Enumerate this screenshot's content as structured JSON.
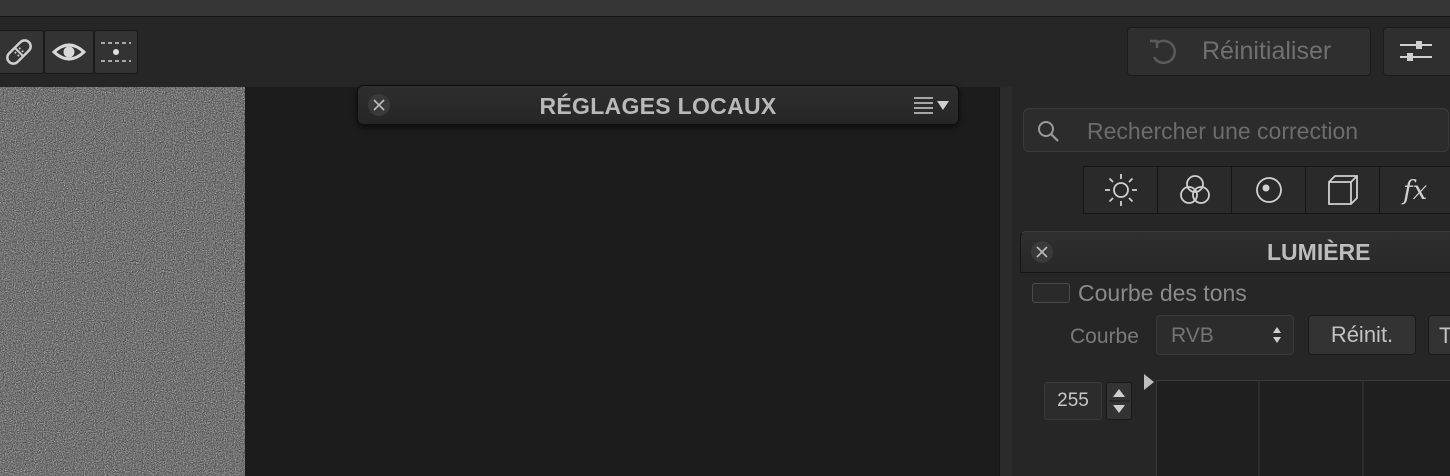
{
  "toolbar": {
    "left_tools": [
      {
        "icon": "bandage-icon"
      },
      {
        "icon": "eye-icon"
      },
      {
        "icon": "split-view-icon"
      }
    ],
    "reset_label": "Réinitialiser",
    "reset_icon": "undo-icon",
    "prefs_icon": "sliders-icon"
  },
  "local_panel": {
    "title": "RÉGLAGES LOCAUX",
    "close_icon": "close-icon",
    "menu_icon": "list-menu-icon"
  },
  "inspector": {
    "search": {
      "placeholder": "Rechercher une correction",
      "icon": "search-icon"
    },
    "category_tabs": [
      {
        "icon": "sun-icon"
      },
      {
        "icon": "color-circles-icon"
      },
      {
        "icon": "detail-circle-icon"
      },
      {
        "icon": "cube-icon"
      },
      {
        "icon": "fx-icon"
      }
    ],
    "section": {
      "title": "LUMIÈRE",
      "tone_curve_label": "Courbe des tons",
      "curve_label": "Courbe",
      "curve_value": "RVB",
      "reinit_label": "Réinit.",
      "cut_button_label": "T",
      "level_value": "255"
    }
  },
  "colors": {
    "background": "#1e1e1e",
    "panel": "#262626",
    "text_primary": "#c8c8c8",
    "text_muted": "#707070"
  }
}
